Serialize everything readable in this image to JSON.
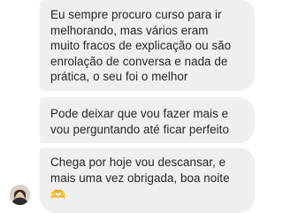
{
  "chat": {
    "messages": [
      {
        "lines": [
          "Eu sempre procuro curso para ir",
          "melhorando,  mas vários eram",
          "muito fracos de explicação ou são",
          "enrolação de conversa e nada de",
          "prática, o seu foi o melhor"
        ]
      },
      {
        "lines": [
          "Pode deixar que vou fazer mais e",
          "vou perguntando até ficar perfeito"
        ]
      },
      {
        "lines": [
          "Chega por hoje vou descansar, e",
          "mais uma vez obrigada, boa noite"
        ],
        "emoji": "🫶",
        "emoji_icon": "heart-hands-icon"
      }
    ]
  },
  "colors": {
    "bubble_bg": "#efefef",
    "text": "#262626",
    "background": "#ffffff"
  }
}
